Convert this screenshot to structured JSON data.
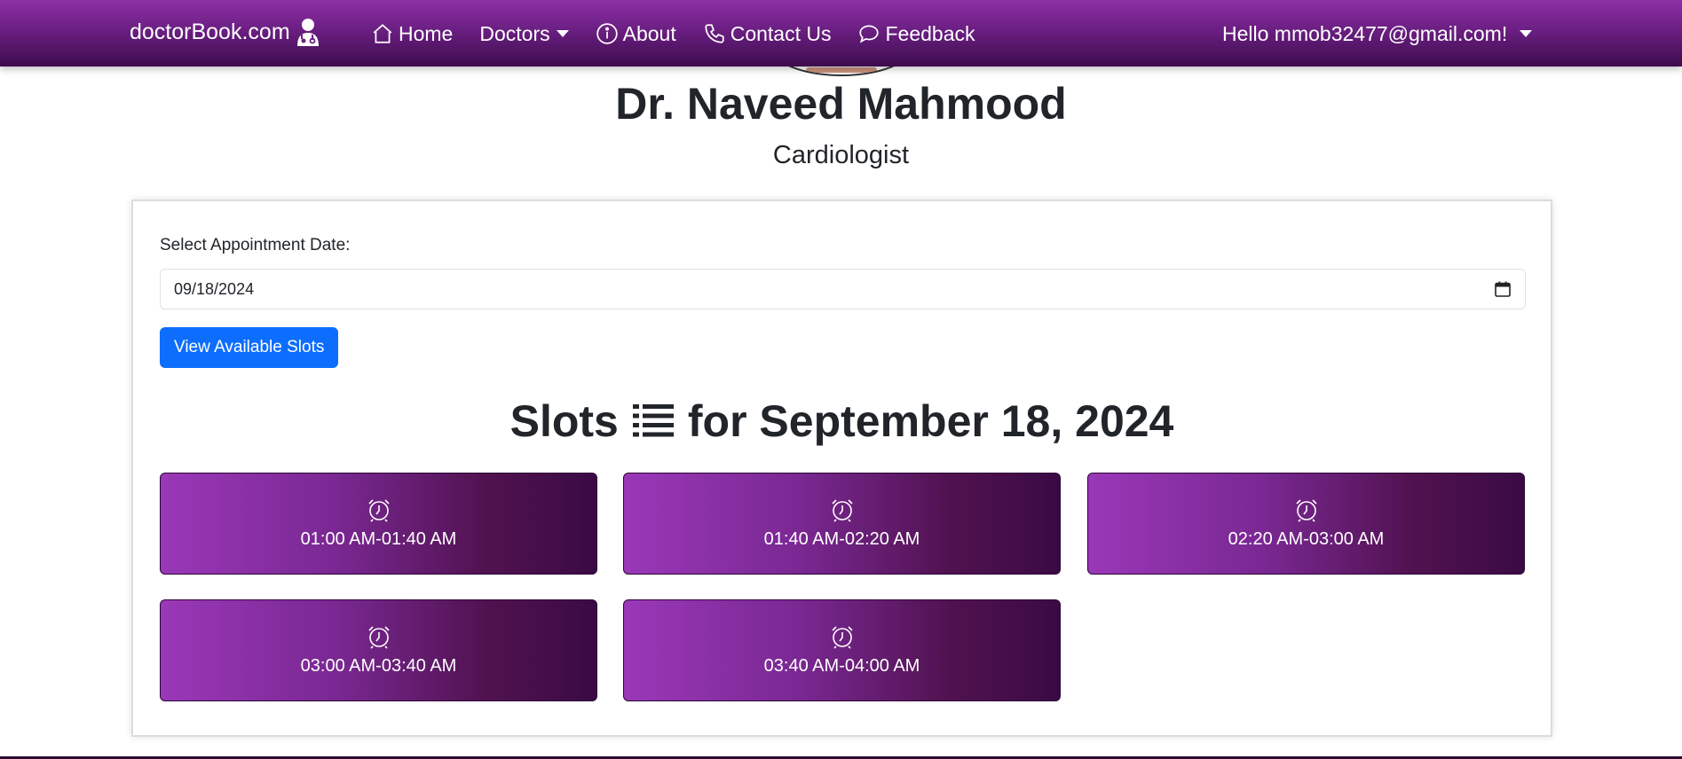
{
  "navbar": {
    "brand": "doctorBook.com",
    "items": [
      {
        "label": "Home",
        "icon": "home-icon"
      },
      {
        "label": "Doctors",
        "icon": "",
        "dropdown": true
      },
      {
        "label": "About",
        "icon": "info-icon"
      },
      {
        "label": "Contact Us",
        "icon": "phone-icon"
      },
      {
        "label": "Feedback",
        "icon": "chat-icon"
      }
    ],
    "user_greeting": "Hello mmob32477@gmail.com!"
  },
  "doctor": {
    "name": "Dr. Naveed Mahmood",
    "specialty": "Cardiologist"
  },
  "appointment": {
    "date_label": "Select Appointment Date:",
    "date_value": "09/18/2024",
    "view_button": "View Available Slots"
  },
  "slots_section": {
    "title_prefix": "Slots",
    "title_suffix": "for September 18, 2024",
    "slots": [
      {
        "time": "01:00 AM-01:40 AM"
      },
      {
        "time": "01:40 AM-02:20 AM"
      },
      {
        "time": "02:20 AM-03:00 AM"
      },
      {
        "time": "03:00 AM-03:40 AM"
      },
      {
        "time": "03:40 AM-04:00 AM"
      }
    ]
  },
  "colors": {
    "navbar_gradient_top": "#8e2fa6",
    "navbar_gradient_bottom": "#3d0c4d",
    "slot_gradient_start": "#9a38b8",
    "slot_gradient_end": "#3a0a45",
    "primary_button": "#0d6efd"
  }
}
